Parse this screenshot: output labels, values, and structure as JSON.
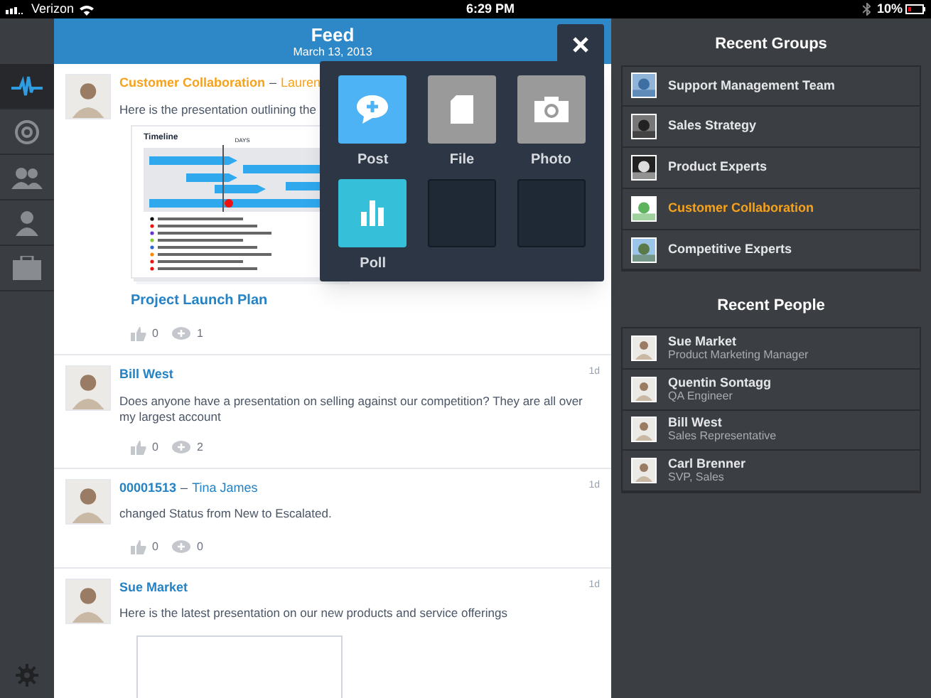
{
  "status_bar": {
    "carrier": "Verizon",
    "time": "6:29 PM",
    "battery": "10%"
  },
  "nav_items": [
    {
      "selected": true
    },
    {
      "selected": false
    },
    {
      "selected": false
    },
    {
      "selected": false
    },
    {
      "selected": false
    }
  ],
  "feed": {
    "title": "Feed",
    "date": "March 13, 2013",
    "posts": [
      {
        "highlighted": true,
        "subject": "Customer Collaboration",
        "separator": "–",
        "author": "Lauren",
        "body": "Here is the presentation outlining the",
        "attachment": {
          "kind": "slide",
          "heading": "Timeline",
          "axis_label": "DAYS",
          "link": "Project Launch Plan"
        },
        "likes": "0",
        "comments": "1"
      },
      {
        "highlighted": false,
        "author": "Bill West",
        "time": "1d",
        "body": "Does anyone have a presentation on selling against our competition?  They are all over my largest account",
        "likes": "0",
        "comments": "2"
      },
      {
        "highlighted": false,
        "subject": "00001513",
        "separator": "–",
        "author": "Tina James",
        "time": "1d",
        "body": "changed Status from New to Escalated.",
        "likes": "0",
        "comments": "0"
      },
      {
        "highlighted": false,
        "author": "Sue Market",
        "time": "1d",
        "body": "Here is the latest presentation on our new products and service offerings",
        "attachment": {
          "kind": "blank"
        }
      }
    ]
  },
  "composer": {
    "options": [
      {
        "kind": "post",
        "label": "Post"
      },
      {
        "kind": "file",
        "label": "File"
      },
      {
        "label": "Photo"
      },
      {
        "kind": "poll",
        "label": "Poll"
      },
      {
        "kind": "empty"
      },
      {
        "kind": "empty"
      }
    ]
  },
  "recent_groups": {
    "title": "Recent Groups",
    "items": [
      {
        "name": "Support Management Team",
        "selected": false
      },
      {
        "name": "Sales Strategy",
        "selected": false
      },
      {
        "name": "Product Experts",
        "selected": false
      },
      {
        "name": "Customer Collaboration",
        "selected": true
      },
      {
        "name": "Competitive Experts",
        "selected": false
      }
    ]
  },
  "recent_people": {
    "title": "Recent People",
    "items": [
      {
        "name": "Sue Market",
        "title": "Product Marketing Manager"
      },
      {
        "name": "Quentin Sontagg",
        "title": "QA Engineer"
      },
      {
        "name": "Bill West",
        "title": "Sales Representative"
      },
      {
        "name": "Carl Brenner",
        "title": "SVP, Sales"
      }
    ]
  }
}
